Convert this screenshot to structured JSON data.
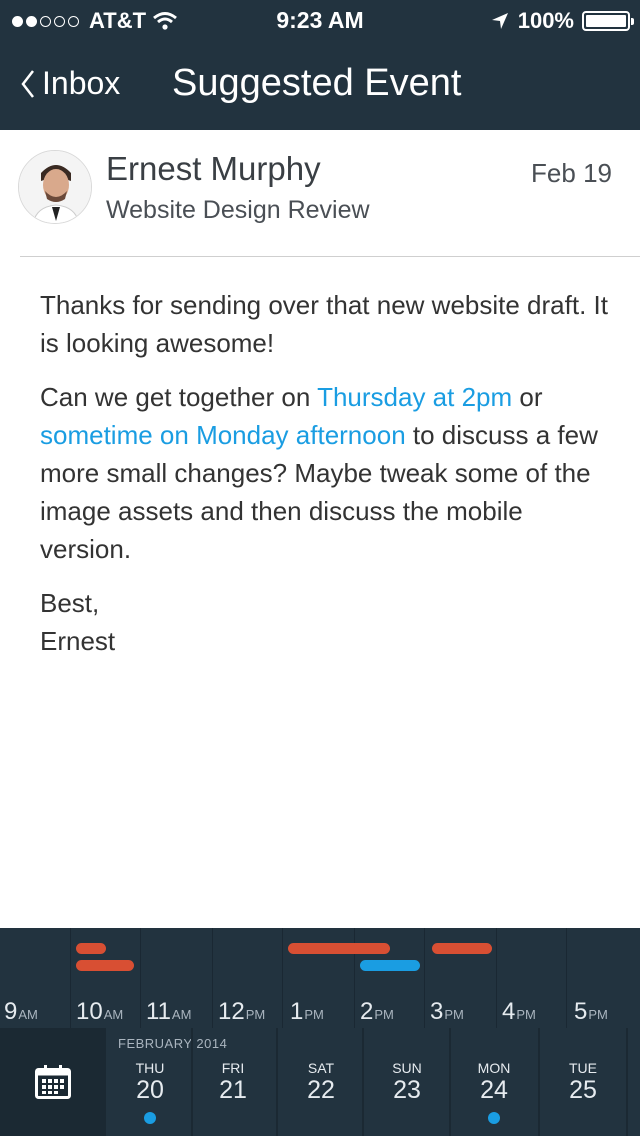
{
  "status": {
    "carrier": "AT&T",
    "time": "9:23 AM",
    "battery": "100%",
    "signal_bars_on": 2,
    "signal_bars_total": 5
  },
  "nav": {
    "back_label": "Inbox",
    "title": "Suggested Event"
  },
  "message": {
    "sender": "Ernest Murphy",
    "subject": "Website Design Review",
    "date": "Feb 19",
    "p1": "Thanks for sending over that new website draft. It is looking awesome!",
    "p2_a": "Can we get together on ",
    "p2_link1": "Thursday at 2pm",
    "p2_b": " or ",
    "p2_link2": "sometime on Monday afternoon",
    "p2_c": " to discuss a few more small changes? Maybe tweak some of the image assets and then discuss the mobile version.",
    "closing": "Best,",
    "signature": "Ernest"
  },
  "timeline": {
    "hours": [
      {
        "num": "9",
        "ampm": "AM"
      },
      {
        "num": "10",
        "ampm": "AM"
      },
      {
        "num": "11",
        "ampm": "AM"
      },
      {
        "num": "12",
        "ampm": "PM"
      },
      {
        "num": "1",
        "ampm": "PM"
      },
      {
        "num": "2",
        "ampm": "PM"
      },
      {
        "num": "3",
        "ampm": "PM"
      },
      {
        "num": "4",
        "ampm": "PM"
      },
      {
        "num": "5",
        "ampm": "PM"
      }
    ]
  },
  "datestrip": {
    "month": "FEBRUARY 2014",
    "days": [
      {
        "dow": "THU",
        "num": "20",
        "has_event": true
      },
      {
        "dow": "FRI",
        "num": "21",
        "has_event": false
      },
      {
        "dow": "SAT",
        "num": "22",
        "has_event": false
      },
      {
        "dow": "SUN",
        "num": "23",
        "has_event": false
      },
      {
        "dow": "MON",
        "num": "24",
        "has_event": true
      },
      {
        "dow": "TUE",
        "num": "25",
        "has_event": false
      }
    ]
  },
  "colors": {
    "header_bg": "#22333f",
    "link": "#1a9de2",
    "busy": "#d84f33",
    "suggested": "#1a9de2"
  }
}
